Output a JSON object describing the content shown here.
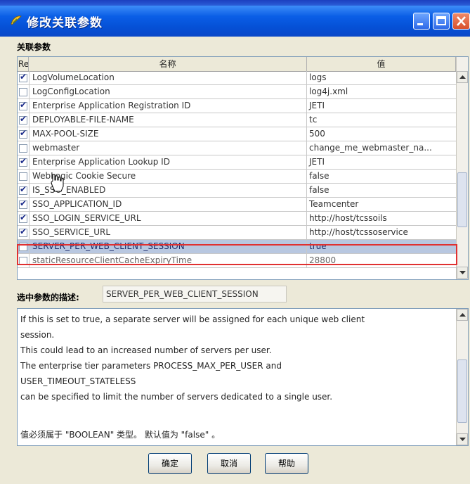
{
  "window": {
    "title": "修改关联参数"
  },
  "group": {
    "label": "关联参数"
  },
  "table": {
    "headers": {
      "req": "Req",
      "name": "名称",
      "value": "值"
    },
    "rows": [
      {
        "req": true,
        "name": "LogVolumeLocation",
        "value": "logs"
      },
      {
        "req": false,
        "name": "LogConfigLocation",
        "value": "log4j.xml"
      },
      {
        "req": true,
        "name": "Enterprise Application Registration ID",
        "value": "JETI"
      },
      {
        "req": true,
        "name": "DEPLOYABLE-FILE-NAME",
        "value": "tc"
      },
      {
        "req": true,
        "name": "MAX-POOL-SIZE",
        "value": "500"
      },
      {
        "req": false,
        "name": "webmaster",
        "value": "change_me_webmaster_na..."
      },
      {
        "req": true,
        "name": "Enterprise Application Lookup ID",
        "value": "JETI"
      },
      {
        "req": false,
        "name": "WebLogic Cookie Secure",
        "value": "false"
      },
      {
        "req": true,
        "name": "IS_SSO_ENABLED",
        "value": "false"
      },
      {
        "req": true,
        "name": "SSO_APPLICATION_ID",
        "value": "Teamcenter"
      },
      {
        "req": true,
        "name": "SSO_LOGIN_SERVICE_URL",
        "value": "http://host/tcssoils"
      },
      {
        "req": true,
        "name": "SSO_SERVICE_URL",
        "value": "http://host/tcssoservice"
      },
      {
        "req": false,
        "name": "SERVER_PER_WEB_CLIENT_SESSION",
        "value": "true"
      },
      {
        "req": false,
        "name": "staticResourceClientCacheExpiryTime",
        "value": "28800"
      }
    ],
    "selected_index": 12
  },
  "description": {
    "label": "选中参数的描述:",
    "param_name": "SERVER_PER_WEB_CLIENT_SESSION",
    "lines": [
      "If this is set to true, a separate server will be assigned for each unique web client",
      "session.",
      "This could lead to an increased number of servers per user.",
      "The enterprise tier parameters PROCESS_MAX_PER_USER and",
      "USER_TIMEOUT_STATELESS",
      "can be specified to limit the number of servers dedicated to a single user.",
      "",
      "值必须属于 \"BOOLEAN\" 类型。 默认值为 \"false\" 。"
    ]
  },
  "buttons": {
    "ok": "确定",
    "cancel": "取消",
    "help": "帮助"
  }
}
